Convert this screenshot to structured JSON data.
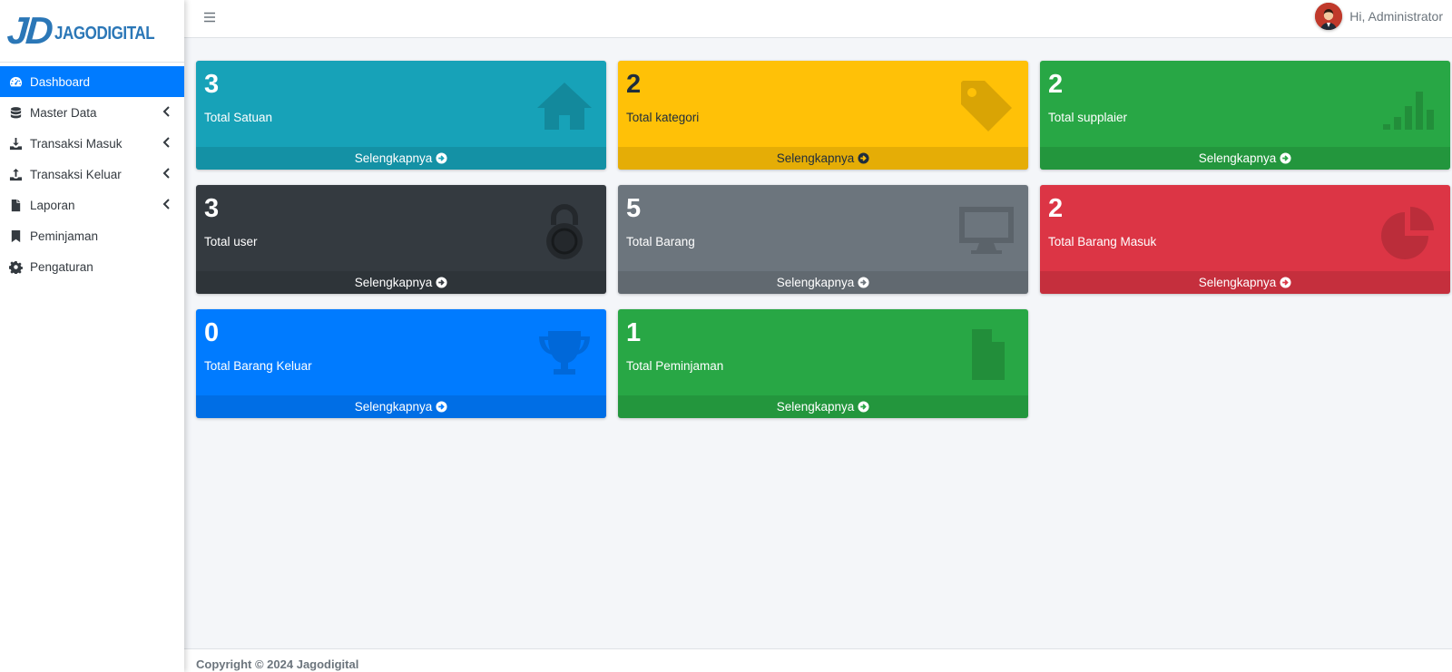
{
  "brand": {
    "logo_mark": "JD",
    "logo_text": "JAGODIGITAL"
  },
  "sidebar": {
    "items": [
      {
        "label": "Dashboard",
        "icon": "tachometer-icon",
        "active": true,
        "has_children": false
      },
      {
        "label": "Master Data",
        "icon": "database-icon",
        "active": false,
        "has_children": true
      },
      {
        "label": "Transaksi Masuk",
        "icon": "download-icon",
        "active": false,
        "has_children": true
      },
      {
        "label": "Transaksi Keluar",
        "icon": "upload-icon",
        "active": false,
        "has_children": true
      },
      {
        "label": "Laporan",
        "icon": "file-icon",
        "active": false,
        "has_children": true
      },
      {
        "label": "Peminjaman",
        "icon": "bookmark-icon",
        "active": false,
        "has_children": false
      },
      {
        "label": "Pengaturan",
        "icon": "gear-icon",
        "active": false,
        "has_children": false
      }
    ]
  },
  "header": {
    "menu_icon": "hamburger-icon",
    "greeting": "Hi, Administrator"
  },
  "boxes": [
    {
      "value": "3",
      "label": "Total Satuan",
      "link": "Selengkapnya",
      "icon": "home-icon",
      "color": "#17a2b8"
    },
    {
      "value": "2",
      "label": "Total kategori",
      "link": "Selengkapnya",
      "icon": "tag-icon",
      "color": "#ffc107"
    },
    {
      "value": "2",
      "label": "Total supplaier",
      "link": "Selengkapnya",
      "icon": "bar-chart-icon",
      "color": "#28a745"
    },
    {
      "value": "3",
      "label": "Total user",
      "link": "Selengkapnya",
      "icon": "lock-icon",
      "color": "#343a40"
    },
    {
      "value": "5",
      "label": "Total Barang",
      "link": "Selengkapnya",
      "icon": "desktop-icon",
      "color": "#6c757d"
    },
    {
      "value": "2",
      "label": "Total Barang Masuk",
      "link": "Selengkapnya",
      "icon": "pie-chart-icon",
      "color": "#dc3545"
    },
    {
      "value": "0",
      "label": "Total Barang Keluar",
      "link": "Selengkapnya",
      "icon": "trophy-icon",
      "color": "#007bff"
    },
    {
      "value": "1",
      "label": "Total Peminjaman",
      "link": "Selengkapnya",
      "icon": "document-icon",
      "color": "#28a745"
    }
  ],
  "footer": {
    "copyright": "Copyright © 2024 Jagodigital"
  }
}
